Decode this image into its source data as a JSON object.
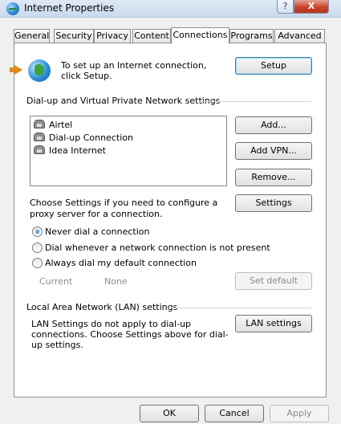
{
  "window": {
    "title": "Internet Properties",
    "help_glyph": "?",
    "close_glyph": "X"
  },
  "tabs": [
    "General",
    "Security",
    "Privacy",
    "Content",
    "Connections",
    "Programs",
    "Advanced"
  ],
  "active_tab": "Connections",
  "setup": {
    "text": "To set up an Internet connection, click Setup.",
    "button": "Setup"
  },
  "dialup": {
    "group_label": "Dial-up and Virtual Private Network settings",
    "connections": [
      "Airtel",
      "Dial-up Connection",
      "Idea Internet"
    ],
    "add_button": "Add...",
    "add_vpn_button": "Add VPN...",
    "remove_button": "Remove...",
    "settings_text": "Choose Settings if you need to configure a proxy server for a connection.",
    "settings_button": "Settings",
    "options": [
      {
        "label": "Never dial a connection",
        "checked": true
      },
      {
        "label": "Dial whenever a network connection is not present",
        "checked": false
      },
      {
        "label": "Always dial my default connection",
        "checked": false
      }
    ],
    "current_label": "Current",
    "current_value": "None",
    "set_default_button": "Set default"
  },
  "lan": {
    "group_label": "Local Area Network (LAN) settings",
    "text": "LAN Settings do not apply to dial-up connections. Choose Settings above for dial-up settings.",
    "button": "LAN settings"
  },
  "footer": {
    "ok": "OK",
    "cancel": "Cancel",
    "apply": "Apply"
  }
}
